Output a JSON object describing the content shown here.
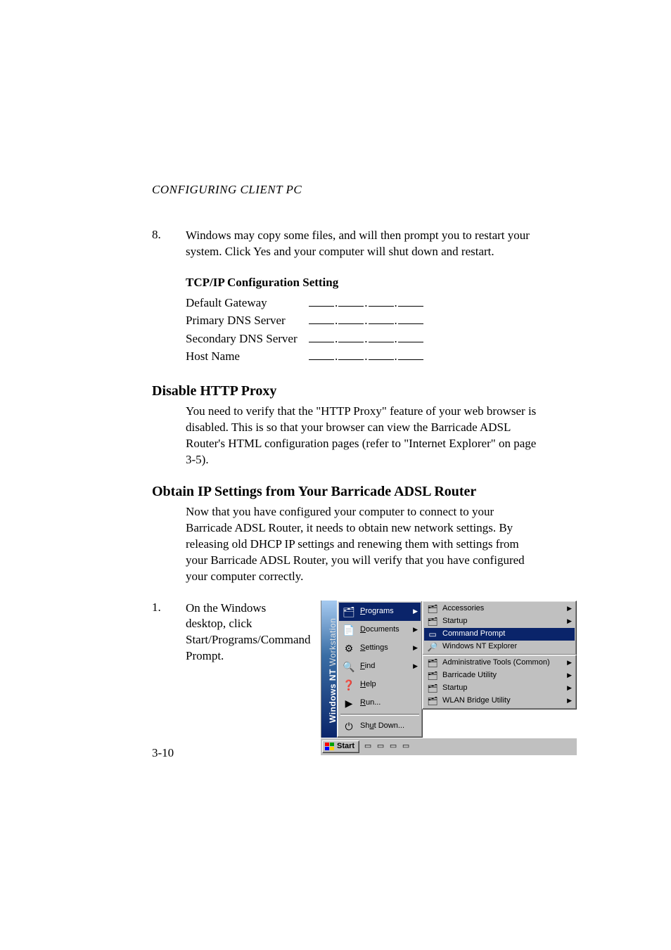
{
  "header": "CONFIGURING CLIENT PC",
  "step8": {
    "num": "8.",
    "text": "Windows may copy some files, and will then prompt you to restart your system. Click Yes and your computer will shut down and restart."
  },
  "config": {
    "heading": "TCP/IP Configuration Setting",
    "rows": [
      "Default Gateway",
      "Primary DNS Server",
      "Secondary DNS Server",
      "Host Name"
    ]
  },
  "proxy": {
    "heading": "Disable HTTP Proxy",
    "para": "You need to verify that the \"HTTP Proxy\" feature of your web browser is disabled. This is so that your browser can view the Barricade ADSL Router's HTML configuration pages (refer to \"Internet Explorer\" on page 3-5)."
  },
  "obtain": {
    "heading": "Obtain IP Settings from Your Barricade ADSL Router",
    "para": "Now that you have configured your computer to connect to your Barricade ADSL Router, it needs to obtain new network settings. By releasing old DHCP IP settings and renewing them with settings from your Barricade ADSL Router, you will verify that you have configured your computer correctly."
  },
  "step1": {
    "num": "1.",
    "text": "On the Windows desktop, click Start/Programs/Command Prompt."
  },
  "screenshot": {
    "banner_bold": "Windows NT",
    "banner_light": " Workstation",
    "left_items": [
      {
        "label": "Programs",
        "arrow": true,
        "glyph": "🗂",
        "hi": true,
        "ukey": "P"
      },
      {
        "label": "Documents",
        "arrow": true,
        "glyph": "📄",
        "ukey": "D"
      },
      {
        "label": "Settings",
        "arrow": true,
        "glyph": "⚙",
        "ukey": "S"
      },
      {
        "label": "Find",
        "arrow": true,
        "glyph": "🔍",
        "ukey": "F"
      },
      {
        "label": "Help",
        "arrow": false,
        "glyph": "❓",
        "ukey": "H"
      },
      {
        "label": "Run...",
        "arrow": false,
        "glyph": "▶",
        "ukey": "R"
      }
    ],
    "left_footer": {
      "label": "Shut Down...",
      "glyph": "⏻",
      "ukey": "u"
    },
    "right_top": [
      {
        "label": "Accessories",
        "arrow": true,
        "glyph": "🗂"
      },
      {
        "label": "Startup",
        "arrow": true,
        "glyph": "🗂"
      },
      {
        "label": "Command Prompt",
        "arrow": false,
        "glyph": "▭",
        "hi": true
      },
      {
        "label": "Windows NT Explorer",
        "arrow": false,
        "glyph": "🔎"
      }
    ],
    "right_bottom": [
      {
        "label": "Administrative Tools (Common)",
        "arrow": true,
        "glyph": "🗂"
      },
      {
        "label": "Barricade Utility",
        "arrow": true,
        "glyph": "🗂"
      },
      {
        "label": "Startup",
        "arrow": true,
        "glyph": "🗂"
      },
      {
        "label": "WLAN Bridge Utility",
        "arrow": true,
        "glyph": "🗂"
      }
    ],
    "start_label": "Start"
  },
  "page_number": "3-10"
}
